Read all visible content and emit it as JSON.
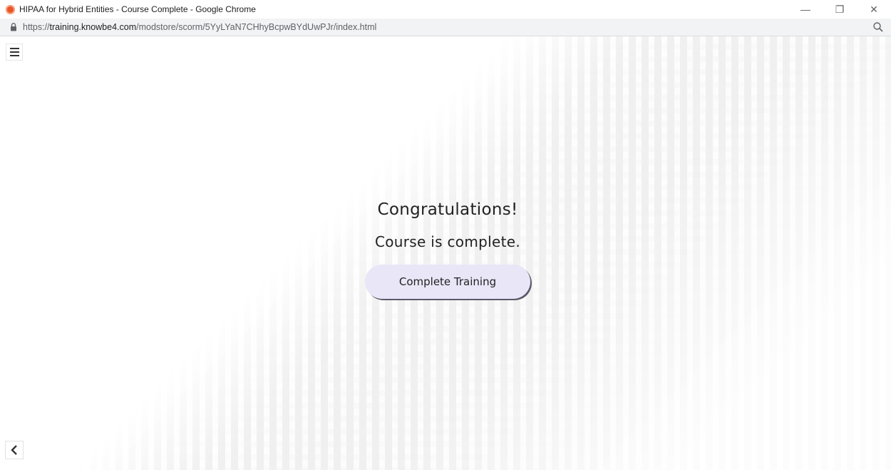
{
  "window": {
    "title": "HIPAA for Hybrid Entities - Course Complete - Google Chrome",
    "minimize_glyph": "—",
    "restore_glyph": "❐",
    "close_glyph": "✕"
  },
  "address_bar": {
    "url_scheme": "https://",
    "url_host": "training.knowbe4.com",
    "url_path": "/modstore/scorm/5YyLYaN7CHhyBcpwBYdUwPJr/index.html",
    "favicon_color": "#e8552a"
  },
  "course": {
    "heading": "Congratulations!",
    "subheading": "Course is complete.",
    "complete_button_label": "Complete Training",
    "button_color": "#e8e6f7"
  },
  "icons": {
    "menu": "hamburger-menu-icon",
    "back": "chevron-left-icon",
    "lock": "lock-icon",
    "zoom": "magnifier-icon"
  }
}
